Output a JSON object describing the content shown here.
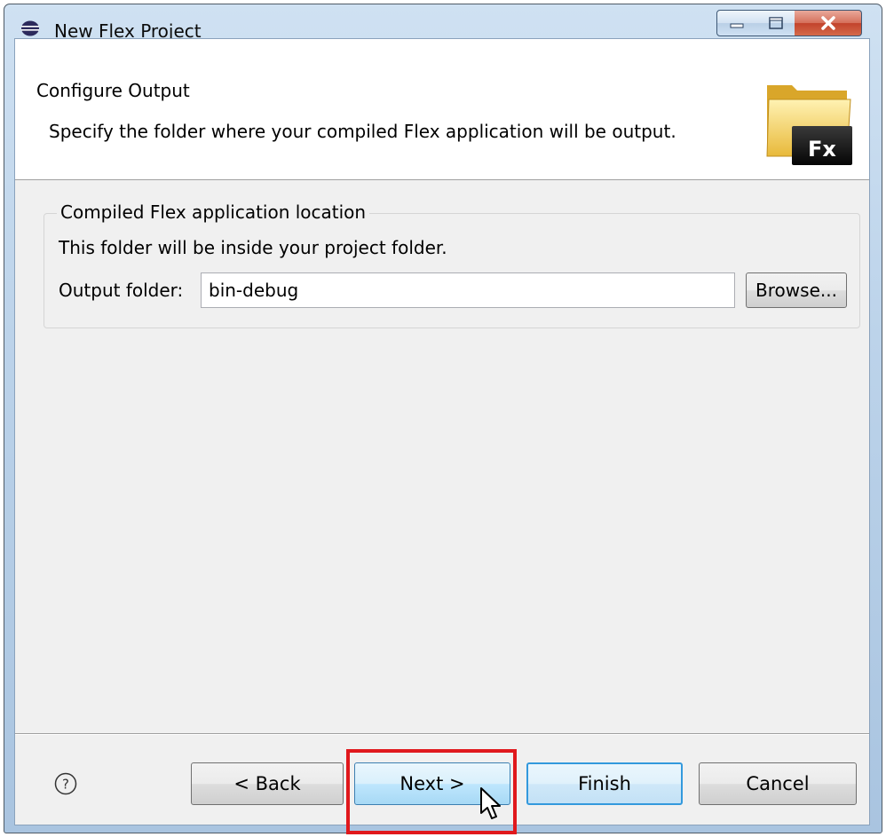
{
  "window": {
    "title": "New Flex Project",
    "icon": "eclipse-icon"
  },
  "header": {
    "title": "Configure Output",
    "description": "Specify the folder where your compiled Flex application will be output.",
    "logo_text": "Fx"
  },
  "group": {
    "title": "Compiled Flex application location",
    "description": "This folder will be inside your project folder.",
    "output_label": "Output folder:",
    "output_value": "bin-debug",
    "browse_label": "Browse..."
  },
  "footer": {
    "help_icon": "help-icon",
    "help_symbol": "?",
    "back_label": "< Back",
    "next_label": "Next >",
    "finish_label": "Finish",
    "cancel_label": "Cancel"
  },
  "colors": {
    "highlight": "#e0181c",
    "default_button_border": "#3399dd"
  }
}
